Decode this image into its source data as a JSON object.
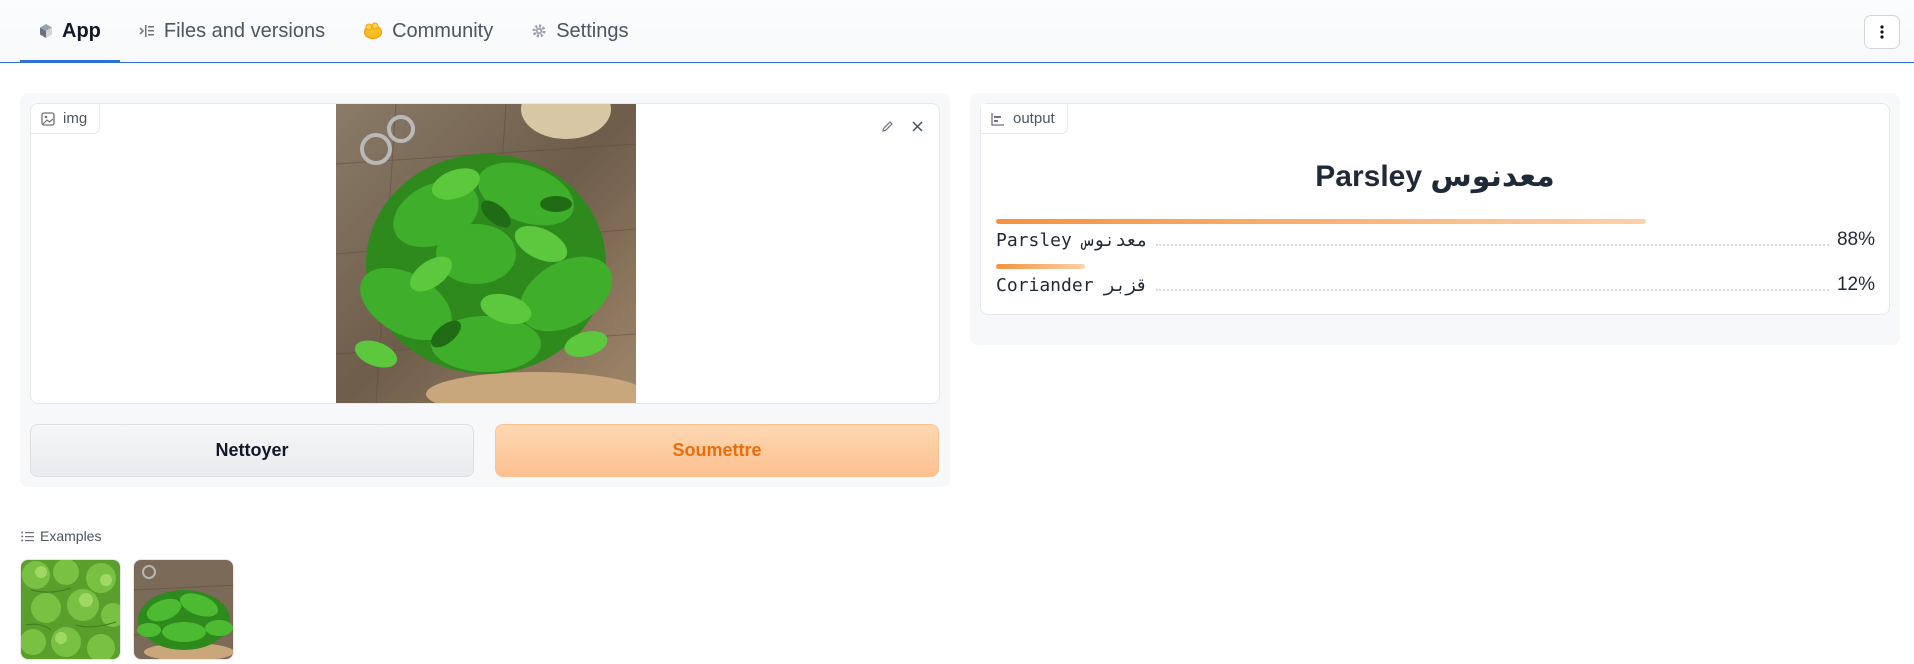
{
  "nav": {
    "tabs": [
      {
        "label": "App",
        "icon": "cube-icon",
        "active": true
      },
      {
        "label": "Files and versions",
        "icon": "files-icon",
        "active": false
      },
      {
        "label": "Community",
        "icon": "community-icon",
        "active": false
      },
      {
        "label": "Settings",
        "icon": "gear-icon",
        "active": false
      }
    ],
    "accent": "#2f6fd6"
  },
  "input": {
    "label": "img",
    "clear_label": "Nettoyer",
    "submit_label": "Soumettre"
  },
  "output": {
    "label": "output",
    "title": "Parsley معدنوس",
    "confidences": [
      {
        "label": "Parsley معدنوس",
        "pct_text": "88%",
        "value": 0.88
      },
      {
        "label": "Coriander قزبر",
        "pct_text": "12%",
        "value": 0.12
      }
    ],
    "bar_color": "#f4923f"
  },
  "examples": {
    "label": "Examples",
    "items": [
      {
        "name": "coriander-leaves"
      },
      {
        "name": "parsley-bunch"
      }
    ]
  }
}
